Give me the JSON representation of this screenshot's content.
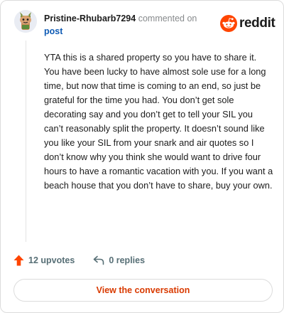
{
  "header": {
    "username": "Pristine-Rhubarb7294",
    "action_text": "commented on",
    "post_link": "post"
  },
  "brand": {
    "wordmark": "reddit",
    "accent_color": "#ff4500"
  },
  "comment": {
    "body": "YTA this is a shared property so you have to share it. You have been lucky to have almost sole use for a long time, but now that time is coming to an end, so just be grateful for the time you had. You don’t get sole decorating say and you don’t get to tell your SIL you can’t reasonably split the property. It doesn’t sound like you like your SIL from your snark and air quotes so I don’t know why you think she would want to drive four hours to have a romantic vacation with you. If you want a beach house that you don’t have to share, buy your own."
  },
  "actions": {
    "upvotes": "12 upvotes",
    "replies": "0 replies"
  },
  "footer": {
    "view_label": "View the conversation"
  },
  "icons": {
    "avatar": "snoo-avatar-icon",
    "logo": "reddit-logo-icon",
    "upvote": "upvote-arrow-icon",
    "reply": "reply-arrow-icon"
  }
}
